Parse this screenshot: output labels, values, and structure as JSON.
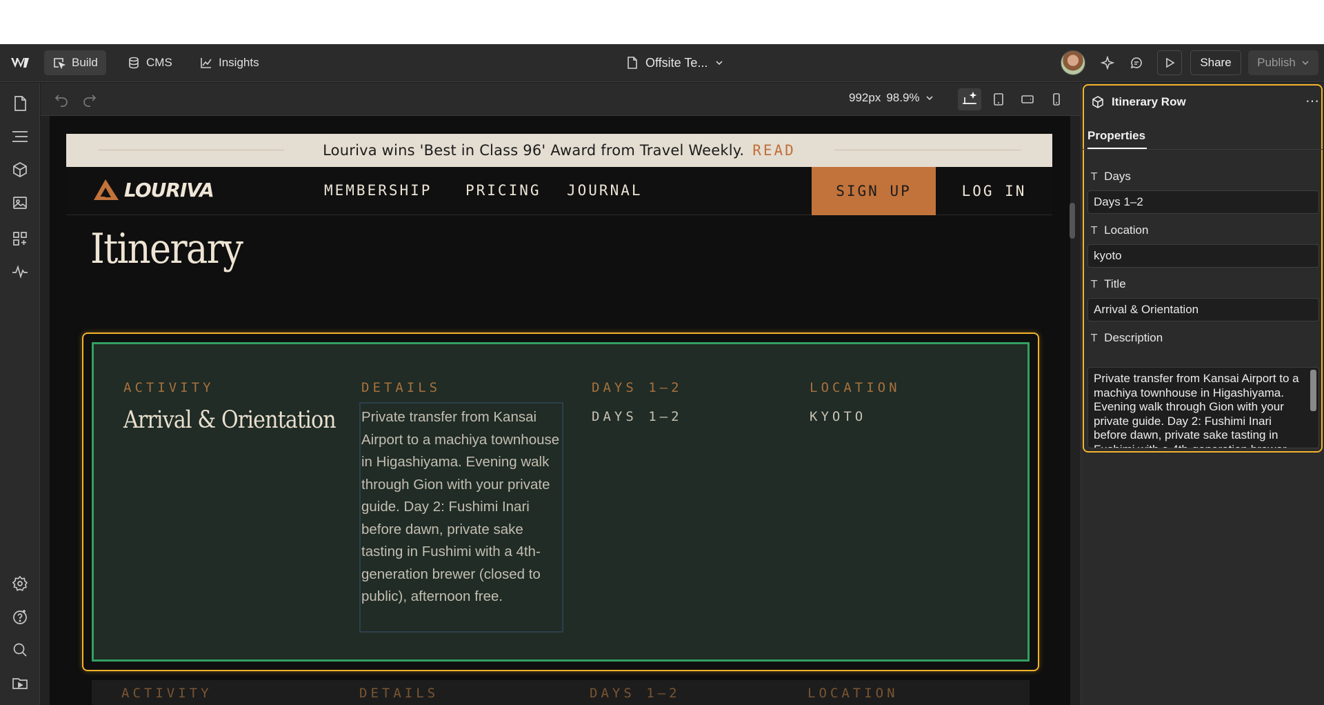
{
  "topbar": {
    "tabs": [
      {
        "label": "Build",
        "icon": "cursor-box-icon",
        "active": true
      },
      {
        "label": "CMS",
        "icon": "database-icon",
        "active": false
      },
      {
        "label": "Insights",
        "icon": "chart-line-icon",
        "active": false
      }
    ],
    "page_name": "Offsite Te...",
    "share_label": "Share",
    "publish_label": "Publish"
  },
  "canvas_toolbar": {
    "width_readout": "992px",
    "zoom_readout": "98.9%"
  },
  "site": {
    "announcement_text": "Louriva wins 'Best in Class 96' Award from Travel Weekly.",
    "announcement_link": "READ",
    "brand": "LOURIVA",
    "nav": [
      "MEMBERSHIP",
      "PRICING",
      "JOURNAL"
    ],
    "signup_label": "SIGN UP",
    "login_label": "LOG IN",
    "heading": "Itinerary",
    "row": {
      "activity_label": "ACTIVITY",
      "details_label": "DETAILS",
      "days_label": "DAYS 1–2",
      "location_label": "LOCATION",
      "title": "Arrival & Orientation",
      "description": "Private transfer from Kansai Airport to a machiya townhouse in Higashiyama. Evening walk through Gion with your private guide. Day 2: Fushimi Inari before dawn, private sake tasting in Fushimi with a 4th-generation brewer (closed to public), afternoon free.",
      "days_value": "DAYS 1–2",
      "location_value": "KYOTO"
    },
    "row2": {
      "activity_label": "ACTIVITY",
      "details_label": "DETAILS",
      "days_label": "DAYS 1–2",
      "location_label": "LOCATION"
    }
  },
  "panel": {
    "component_name": "Itinerary Row",
    "tab_label": "Properties",
    "fields": {
      "days_label": "Days",
      "days_value": "Days 1–2",
      "location_label": "Location",
      "location_value": "kyoto",
      "title_label": "Title",
      "title_value": "Arrival & Orientation",
      "description_label": "Description",
      "description_value": "Private transfer from Kansai Airport to a machiya townhouse in Higashiyama. Evening walk through Gion with your private guide. Day 2: Fushimi Inari before dawn, private sake tasting in Fushimi with a 4th-generation brewer (closed to public), afternoon free."
    }
  },
  "colors": {
    "accent_orange": "#c2733b",
    "selection_yellow": "#f5b42a",
    "row_green_border": "#33a062",
    "row_bg": "#202c25"
  }
}
